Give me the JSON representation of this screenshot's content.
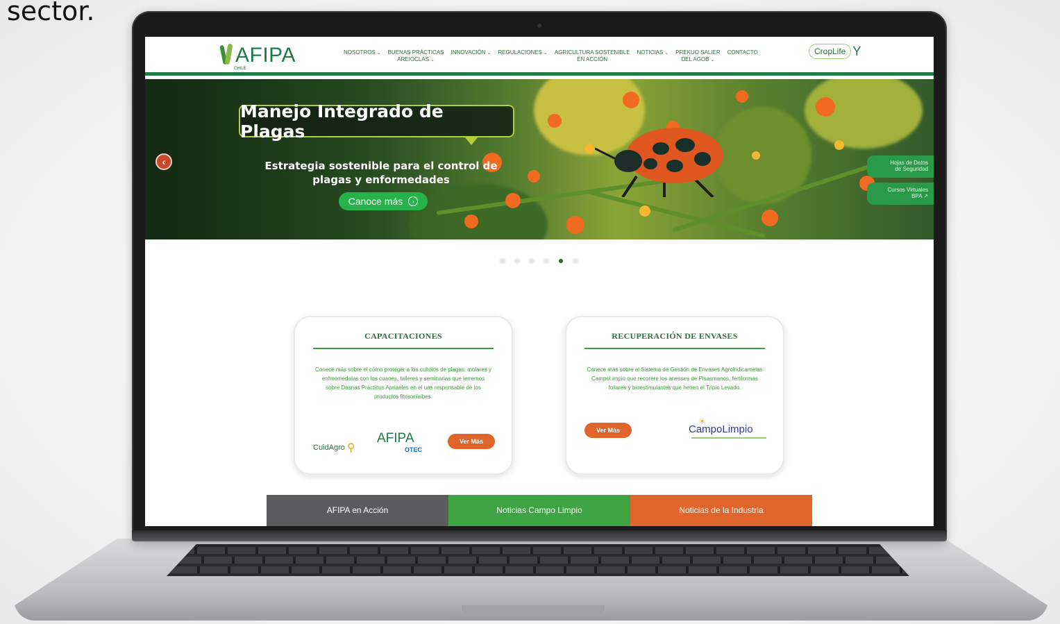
{
  "caption": "sector.",
  "header": {
    "logo_text": "AFIPA",
    "logo_sub": "CHILE",
    "nav": [
      {
        "label": "NOSOTROS",
        "line2": "",
        "chevron": true
      },
      {
        "label": "BUENAS PRÁCTICAS",
        "line2": "AREIOCLAS",
        "chevron": true
      },
      {
        "label": "INNOVACIÓN",
        "line2": "",
        "chevron": true
      },
      {
        "label": "REGULACIONES",
        "line2": "",
        "chevron": true
      },
      {
        "label": "AGRICULTURA SOSTENIBLE",
        "line2": "EN ACCIÓN",
        "chevron": false
      },
      {
        "label": "NOTICIAS",
        "line2": "",
        "chevron": true
      },
      {
        "label": "PREKUO SALIER",
        "line2": "DEL AGOB",
        "chevron": true
      },
      {
        "label": "CONTACTO",
        "line2": "",
        "chevron": false
      }
    ],
    "partner_logo": "CropLife"
  },
  "hero": {
    "title": "Manejo Integrado de Plagas",
    "subtitle": "Estrategia sostenible para el control de plagas y enformedades",
    "cta_label": "Canoce más",
    "side_tabs": [
      {
        "line1": "Hojas de Datos",
        "line2": "de Seguridad"
      },
      {
        "line1": "Cursos Virtuales",
        "line2": "BPA"
      }
    ],
    "slides": 6,
    "active_slide": 5
  },
  "cards": [
    {
      "title": "CAPACITACIONES",
      "text": "Conece más sobre el cómo proteger a los cultolos de plagas, molares y enfmomedalas con los cuaoes, talleres y seminarias que lerremos sobre Dasnas Prácticus Apriaeles en el uas responsable de los productos fitosonlaibes.",
      "button": "Ver Más",
      "logos": [
        "CuidAgro",
        "AFIPA",
        "OTEC"
      ]
    },
    {
      "title": "RECUPERACIÓN DE ENVASES",
      "text": "Conece más sobre el Sistema de Gestión de Envases Agrolndicarnelas Campol.impio que recorere los anesses de Pisasmanos, fertilormas follares y bioestimulantes que henen el Tripio Levado.",
      "button": "Ver Más",
      "logos": [
        "CampoLimpio"
      ]
    }
  ],
  "bottom_tabs": [
    {
      "label": "AFIPA en Acción",
      "color": "#5b5b5e"
    },
    {
      "label": "Noticias Campo Limpio",
      "color": "#3ea443"
    },
    {
      "label": "Noticias de la Industria",
      "color": "#e0652c"
    }
  ]
}
